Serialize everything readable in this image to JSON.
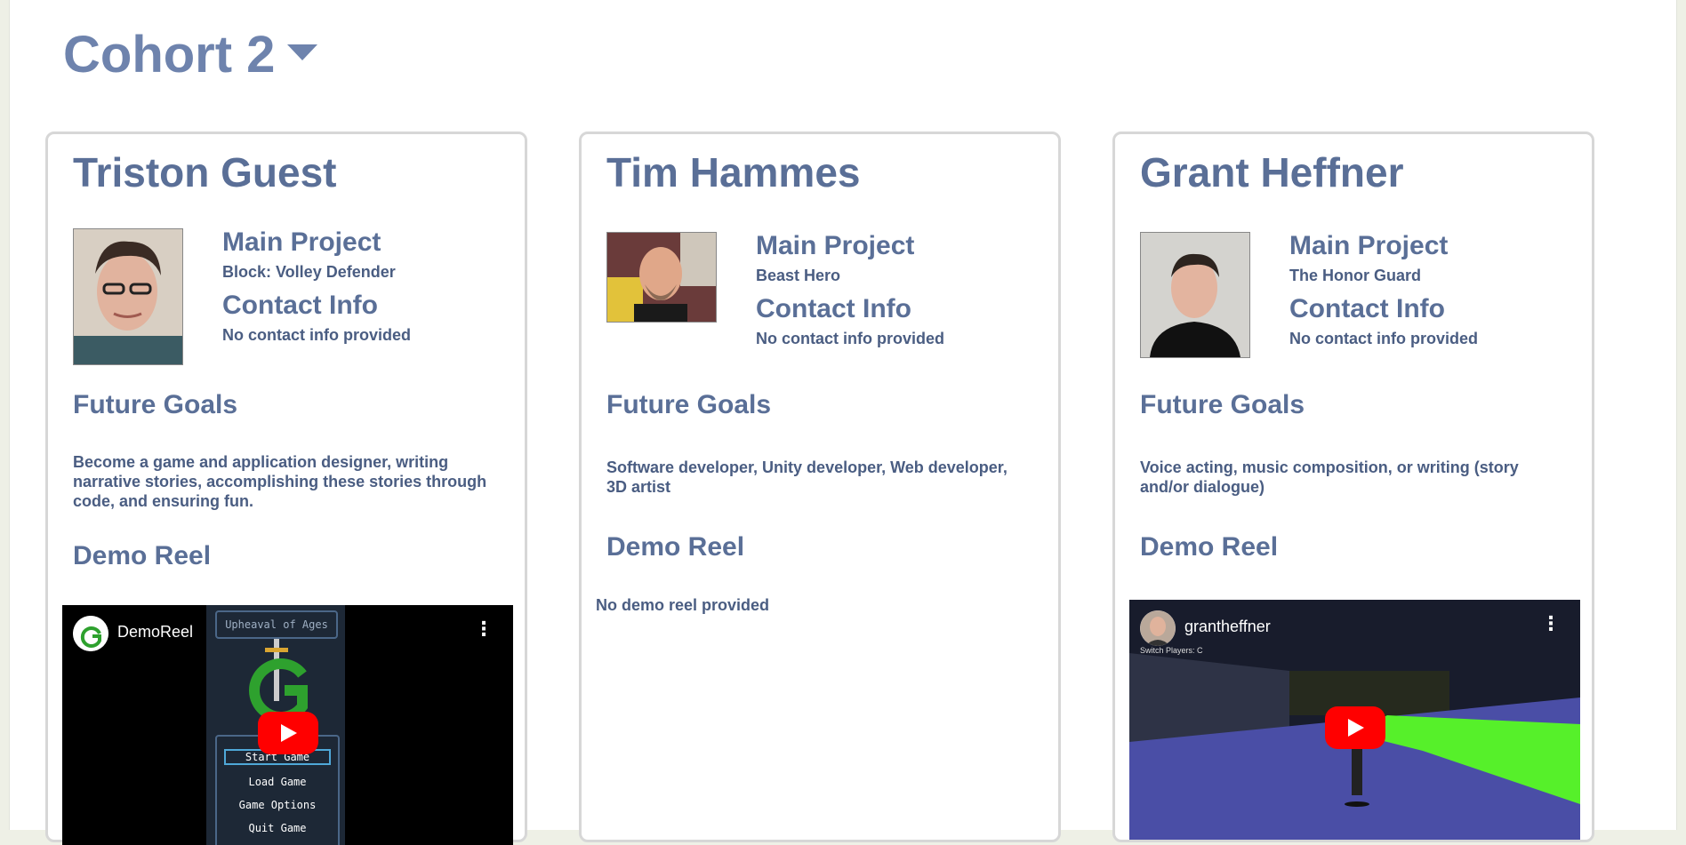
{
  "cohort": {
    "title": "Cohort 2"
  },
  "labels": {
    "main_project": "Main Project",
    "contact_info": "Contact Info",
    "future_goals": "Future Goals",
    "demo_reel": "Demo Reel"
  },
  "students": [
    {
      "name": "Triston Guest",
      "project": "Block: Volley Defender",
      "contact": "No contact info provided",
      "goals": "Become a game and application designer, writing narrative stories, accomplishing these stories through code, and ensuring fun.",
      "video": {
        "channel_title": "DemoReel",
        "game_title": "Upheaval of Ages",
        "menu": [
          "Start Game",
          "Load Game",
          "Game Options",
          "Quit Game"
        ]
      }
    },
    {
      "name": "Tim Hammes",
      "project": "Beast Hero",
      "contact": "No contact info provided",
      "goals": "Software developer, Unity developer, Web developer, 3D artist",
      "no_demo": "No demo reel provided"
    },
    {
      "name": "Grant Heffner",
      "project": "The Honor Guard",
      "contact": "No contact info provided",
      "goals": "Voice acting, music composition, or writing (story and/or dialogue)",
      "video": {
        "channel_title": "grantheffner",
        "hud_text": "Switch Players: C"
      }
    }
  ],
  "colors": {
    "heading": "#5a6f97",
    "cohort": "#6e83ad",
    "youtube_red": "#ff0000",
    "page_bg": "#eef0e6"
  },
  "icons": [
    "chevron-down-icon",
    "play-icon",
    "more-vert-icon"
  ]
}
